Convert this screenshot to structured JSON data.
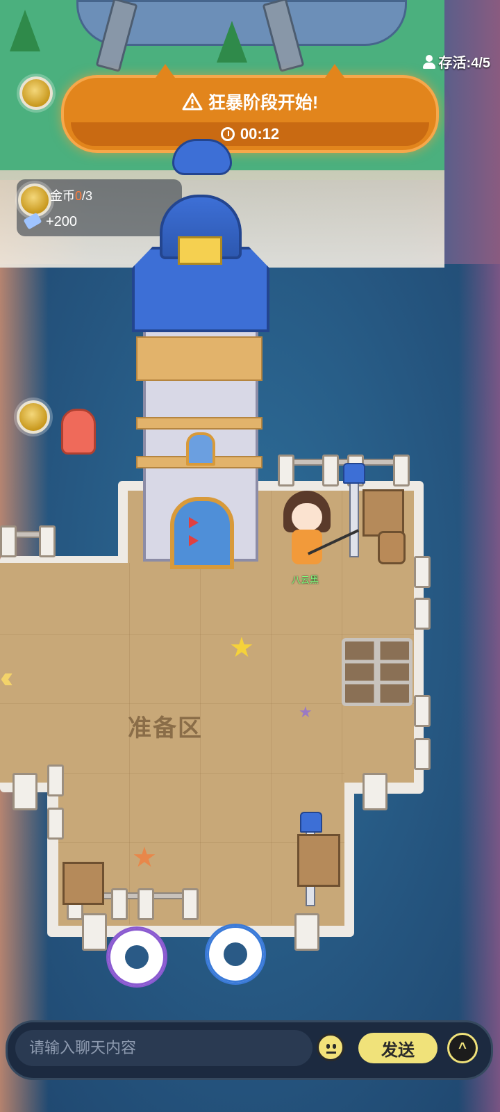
{
  "hud": {
    "survival_text": "存活:4/5"
  },
  "alert": {
    "title": "狂暴阶段开始!",
    "timer": "00:12"
  },
  "objective": {
    "coin_label_prefix": "金币",
    "coin_current": "0",
    "coin_total": "/3",
    "reward": "+200"
  },
  "world": {
    "zone_label": "准备区",
    "player_name": "八云黑"
  },
  "chat": {
    "placeholder": "请输入聊天内容",
    "send_label": "发送",
    "expand_symbol": "^"
  },
  "colors": {
    "alert_orange": "#e2851c",
    "send_yellow": "#f0e27a",
    "coin_current_red": "#ff7b3a"
  }
}
